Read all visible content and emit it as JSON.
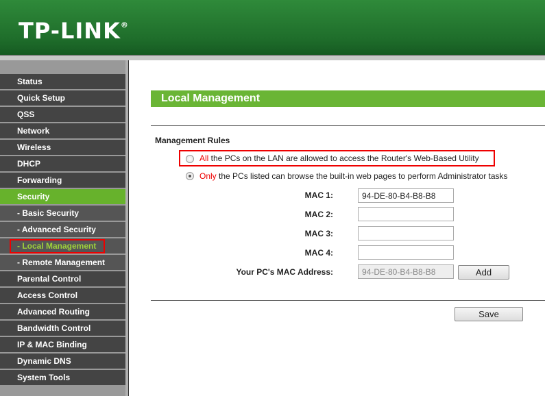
{
  "header": {
    "logo": "TP-LINK",
    "logo_mark": "®"
  },
  "sidebar": {
    "items": [
      {
        "label": "Status"
      },
      {
        "label": "Quick Setup"
      },
      {
        "label": "QSS"
      },
      {
        "label": "Network"
      },
      {
        "label": "Wireless"
      },
      {
        "label": "DHCP"
      },
      {
        "label": "Forwarding"
      },
      {
        "label": "Security"
      },
      {
        "label": "- Basic Security"
      },
      {
        "label": "- Advanced Security"
      },
      {
        "label": "- Local Management"
      },
      {
        "label": "- Remote Management"
      },
      {
        "label": "Parental Control"
      },
      {
        "label": "Access Control"
      },
      {
        "label": "Advanced Routing"
      },
      {
        "label": "Bandwidth Control"
      },
      {
        "label": "IP & MAC Binding"
      },
      {
        "label": "Dynamic DNS"
      },
      {
        "label": "System Tools"
      }
    ]
  },
  "main": {
    "title": "Local Management",
    "rules_label": "Management Rules",
    "option_all": {
      "highlight": "All",
      "text": " the PCs on the LAN are allowed to access the Router's Web-Based Utility",
      "selected": false
    },
    "option_only": {
      "highlight": "Only",
      "text": " the PCs listed can browse the built-in web pages to perform Administrator tasks",
      "selected": true
    },
    "mac_fields": [
      {
        "label": "MAC 1:",
        "value": "94-DE-80-B4-B8-B8"
      },
      {
        "label": "MAC 2:",
        "value": ""
      },
      {
        "label": "MAC 3:",
        "value": ""
      },
      {
        "label": "MAC 4:",
        "value": ""
      }
    ],
    "your_mac_label": "Your PC's MAC Address:",
    "your_mac_value": "94-DE-80-B4-B8-B8",
    "add_label": "Add",
    "save_label": "Save"
  },
  "colors": {
    "accent": "#6ab535",
    "highlight_red": "#ee0000"
  }
}
